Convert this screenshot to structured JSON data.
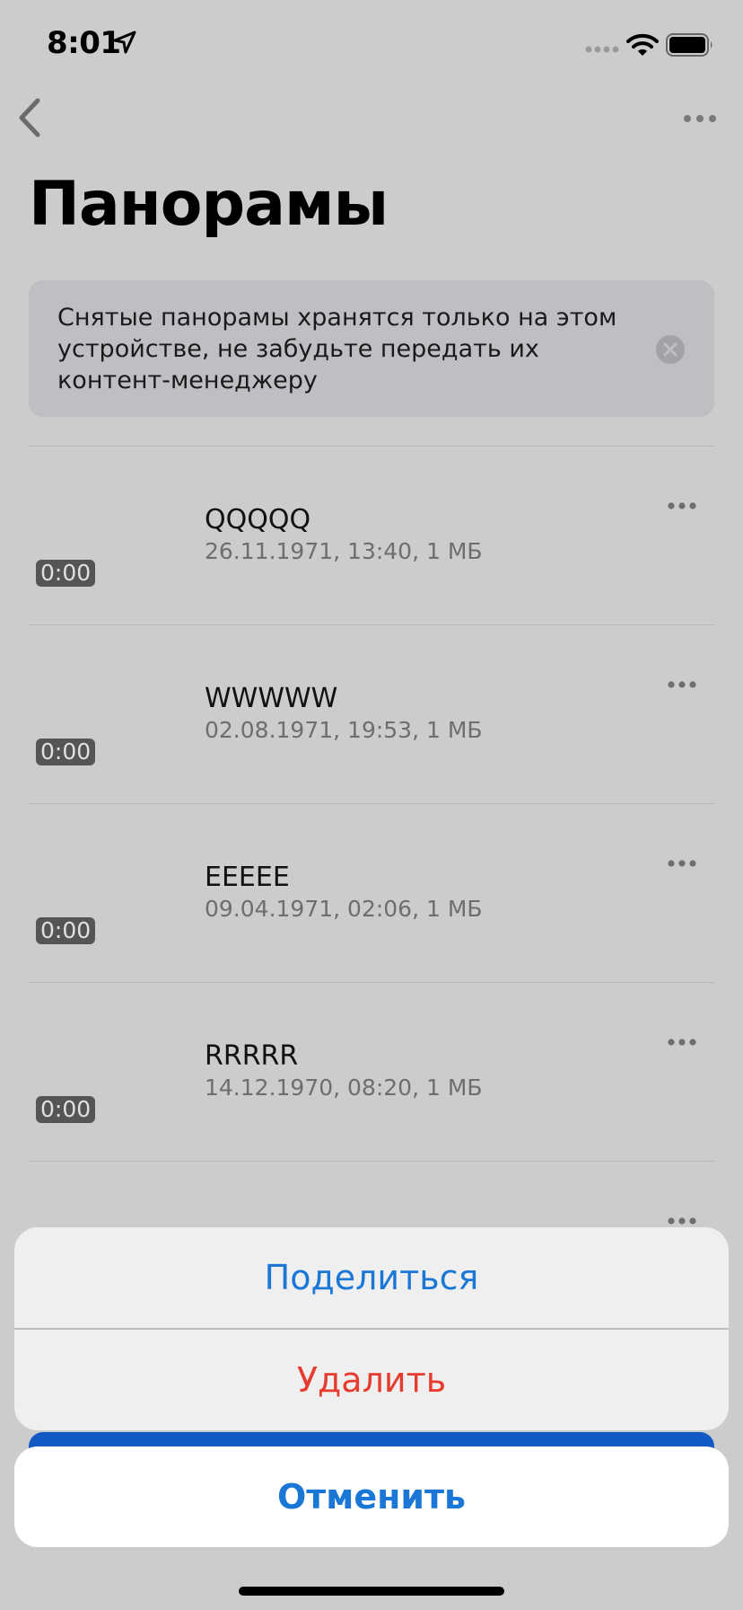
{
  "status": {
    "time": "8:01"
  },
  "header": {
    "title": "Панорамы"
  },
  "banner": {
    "text": "Снятые панорамы хранятся только на этом устройстве, не забудьте передать их контент-менеджеру"
  },
  "list": [
    {
      "duration": "0:00",
      "title": "QQQQQ",
      "meta": "26.11.1971, 13:40, 1 МБ"
    },
    {
      "duration": "0:00",
      "title": "WWWWW",
      "meta": "02.08.1971, 19:53, 1 МБ"
    },
    {
      "duration": "0:00",
      "title": "EEEEE",
      "meta": "09.04.1971, 02:06, 1 МБ"
    },
    {
      "duration": "0:00",
      "title": "RRRRR",
      "meta": "14.12.1970, 08:20, 1 МБ"
    }
  ],
  "action_sheet": {
    "share_label": "Поделиться",
    "delete_label": "Удалить",
    "cancel_label": "Отменить"
  },
  "colors": {
    "accent": "#1a77d6",
    "destructive": "#e63b2e",
    "dim_background": "#cccccc"
  },
  "icons": [
    "location-arrow-icon",
    "cellular-signal-icon",
    "wifi-icon",
    "battery-icon",
    "back-chevron-icon",
    "more-icon",
    "close-icon"
  ]
}
